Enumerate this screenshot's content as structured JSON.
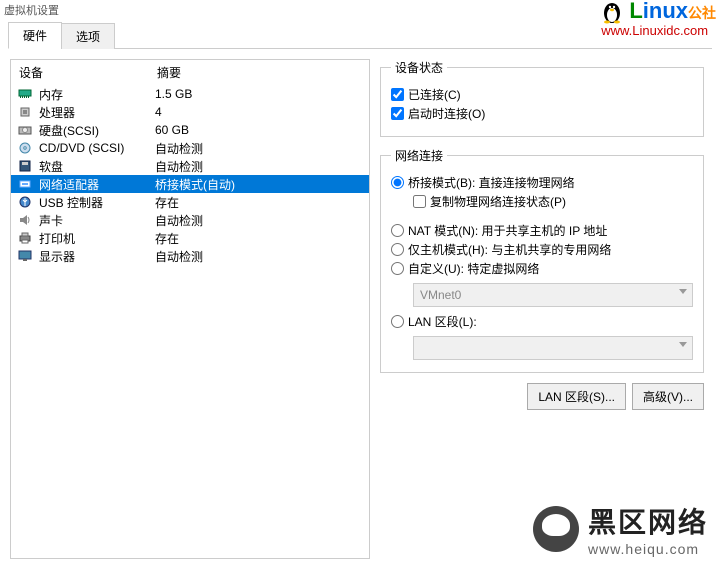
{
  "window_title": "虚拟机设置",
  "top_logo": {
    "brand1": "L",
    "brand2": "inux",
    "brand3": "公社",
    "url": "www.Linuxidc.com"
  },
  "tabs": {
    "hardware": "硬件",
    "options": "选项"
  },
  "list_header": {
    "device": "设备",
    "summary": "摘要"
  },
  "devices": [
    {
      "icon": "memory",
      "name": "内存",
      "summary": "1.5 GB"
    },
    {
      "icon": "cpu",
      "name": "处理器",
      "summary": "4"
    },
    {
      "icon": "disk",
      "name": "硬盘(SCSI)",
      "summary": "60 GB"
    },
    {
      "icon": "cd",
      "name": "CD/DVD (SCSI)",
      "summary": "自动检测"
    },
    {
      "icon": "floppy",
      "name": "软盘",
      "summary": "自动检测"
    },
    {
      "icon": "network",
      "name": "网络适配器",
      "summary": "桥接模式(自动)",
      "selected": true
    },
    {
      "icon": "usb",
      "name": "USB 控制器",
      "summary": "存在"
    },
    {
      "icon": "sound",
      "name": "声卡",
      "summary": "自动检测"
    },
    {
      "icon": "printer",
      "name": "打印机",
      "summary": "存在"
    },
    {
      "icon": "display",
      "name": "显示器",
      "summary": "自动检测"
    }
  ],
  "status": {
    "legend": "设备状态",
    "connected": "已连接(C)",
    "connect_at_power": "启动时连接(O)"
  },
  "network": {
    "legend": "网络连接",
    "bridged": "桥接模式(B): 直接连接物理网络",
    "replicate": "复制物理网络连接状态(P)",
    "nat": "NAT 模式(N): 用于共享主机的 IP 地址",
    "hostonly": "仅主机模式(H): 与主机共享的专用网络",
    "custom": "自定义(U): 特定虚拟网络",
    "vmnet": "VMnet0",
    "lan": "LAN 区段(L):"
  },
  "buttons": {
    "lan_seg": "LAN 区段(S)...",
    "advanced": "高级(V)..."
  },
  "footer_logo": {
    "cn": "黑区网络",
    "en": "www.heiqu.com"
  }
}
